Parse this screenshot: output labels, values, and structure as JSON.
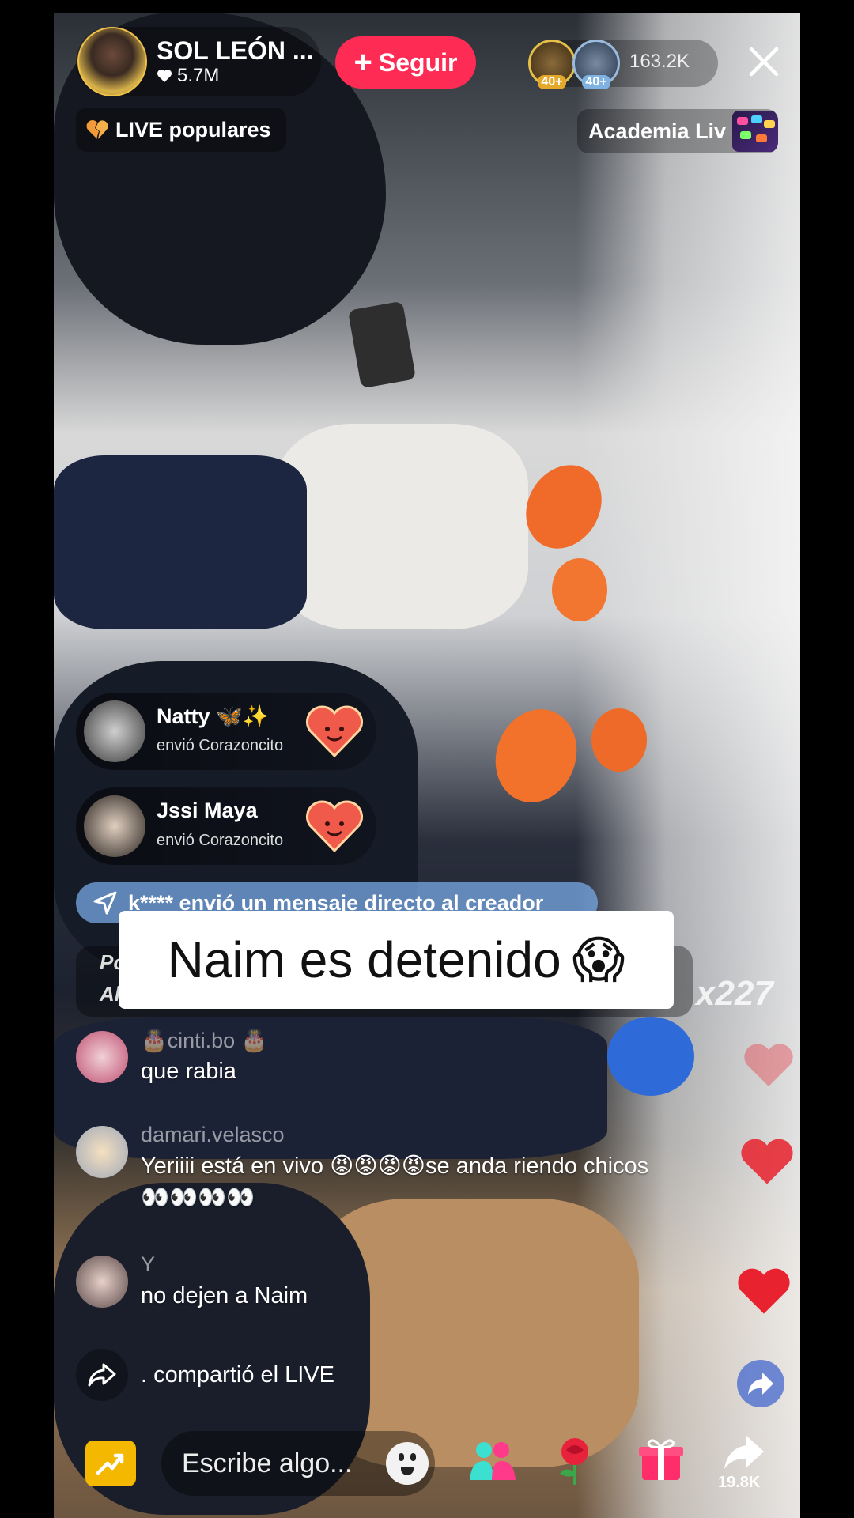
{
  "host": {
    "name": "SOL LEÓN ...",
    "likes": "5.7M",
    "follow_label": "Seguir"
  },
  "viewers": {
    "badge1": "40+",
    "badge2": "40+",
    "count": "163.2K"
  },
  "top_pills": {
    "popular": "LIVE populares",
    "academy": "Academia Liv"
  },
  "gifts": [
    {
      "name": "Natty 🦋✨",
      "action": "envió Corazoncito"
    },
    {
      "name": "Jssi Maya",
      "action": "envió Corazoncito"
    }
  ],
  "direct_message": "k**** envió un mensaje directo al creador",
  "ghost": {
    "line1": "Po",
    "line2": "Al"
  },
  "combo": "x227",
  "caption": {
    "text": "Naim es detenido",
    "emoji": "😱"
  },
  "comments": [
    {
      "user": "🎂cinti.bo 🎂",
      "text": "que rabia"
    },
    {
      "user": "damari.velasco",
      "text": "Yeriiii está en vivo 😡😡😡😡se anda riendo chicos",
      "text2": "👀👀👀👀"
    },
    {
      "user": "Y",
      "text": "no dejen a Naim"
    }
  ],
  "share_event": ". compartió el LIVE",
  "input": {
    "placeholder": "Escribe algo..."
  },
  "share_count": "19.8K",
  "colors": {
    "follow": "#fe2c55",
    "heart": "#e8222e",
    "dm_banner": "#78aae6",
    "trend": "#f5b800"
  }
}
